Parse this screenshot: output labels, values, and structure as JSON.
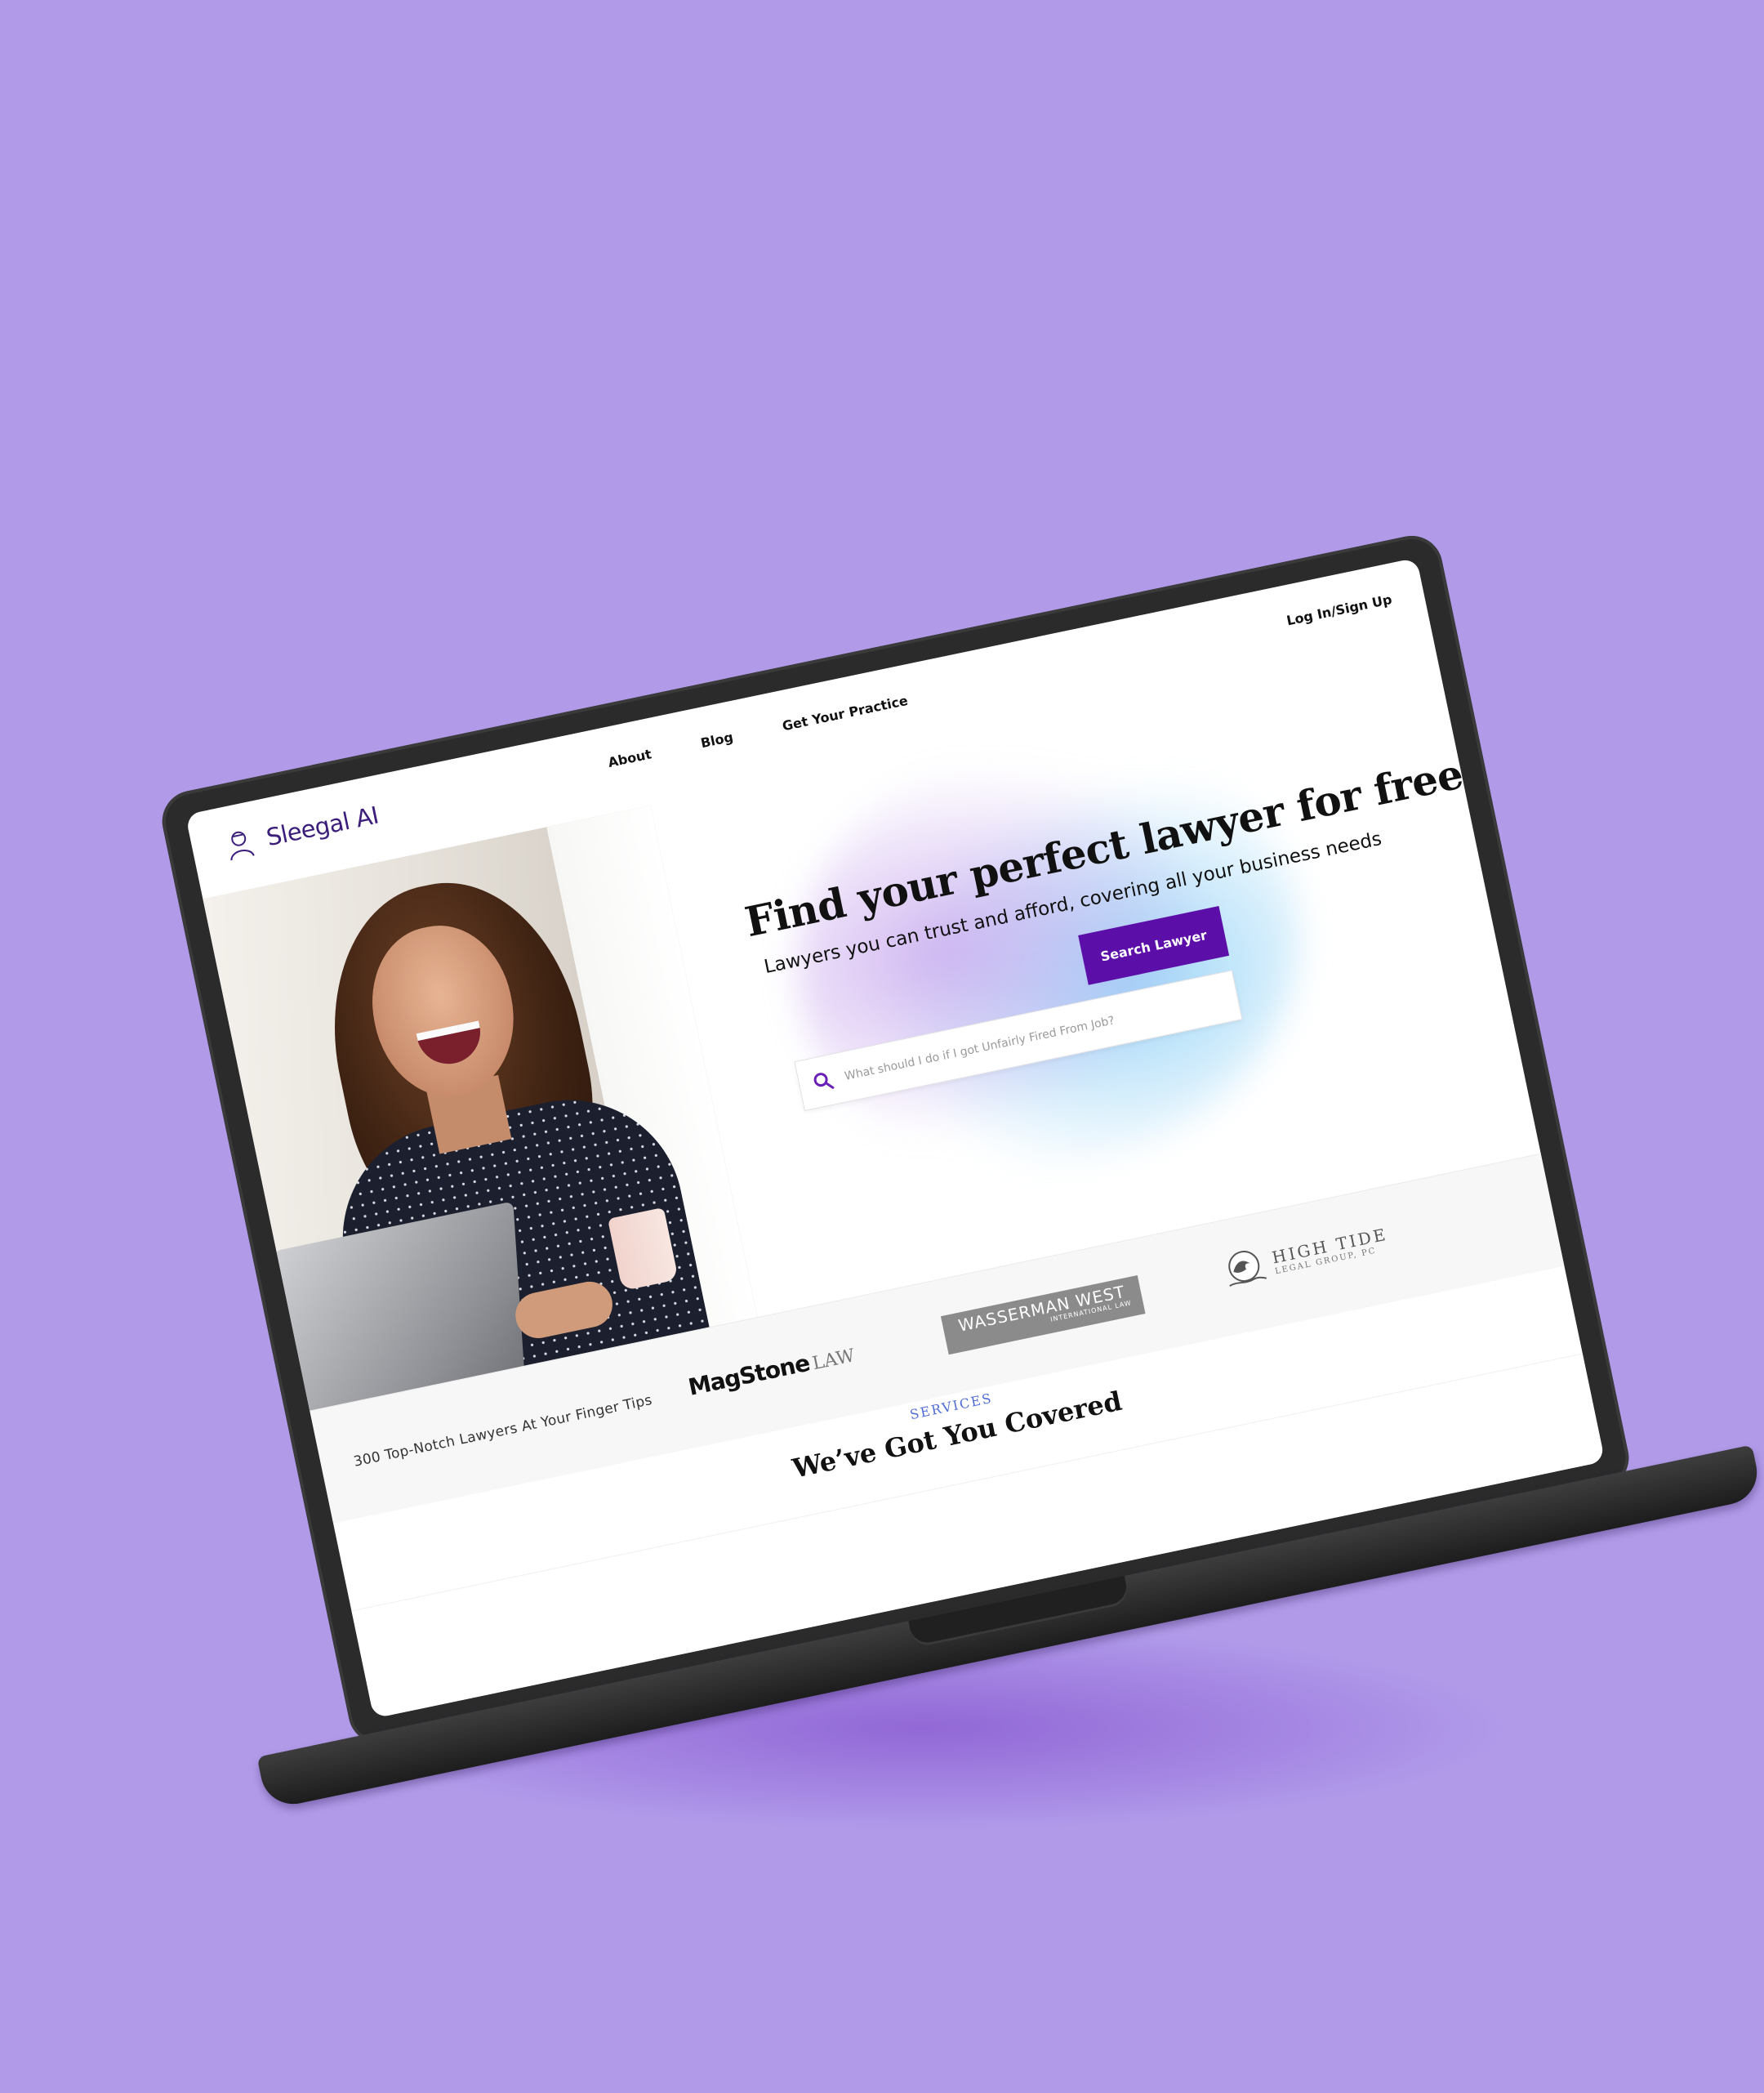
{
  "brand": {
    "name": "Sleegal AI",
    "accent": "#5c0fa8",
    "background": "#b19be9"
  },
  "nav": {
    "links": [
      "About",
      "Blog",
      "Get Your Practice"
    ],
    "login": "Log In/Sign Up"
  },
  "hero": {
    "title": "Find your perfect lawyer for free",
    "subtitle": "Lawyers you can trust and afford, covering all your business needs",
    "search_button": "Search Lawyer",
    "search_placeholder": "What should I do if I got Unfairly Fired From Job?"
  },
  "partners": {
    "tagline": "300 Top-Notch Lawyers At Your Finger Tips",
    "magstone": {
      "main": "MagStone",
      "suffix": "LAW"
    },
    "wasserman": {
      "main": "WASSERMAN WEST",
      "sub": "INTERNATIONAL LAW"
    },
    "hightide": {
      "main": "HIGH TIDE",
      "sub": "LEGAL GROUP, PC"
    }
  },
  "services": {
    "label": "SERVICES",
    "title": "We’ve Got You Covered"
  }
}
